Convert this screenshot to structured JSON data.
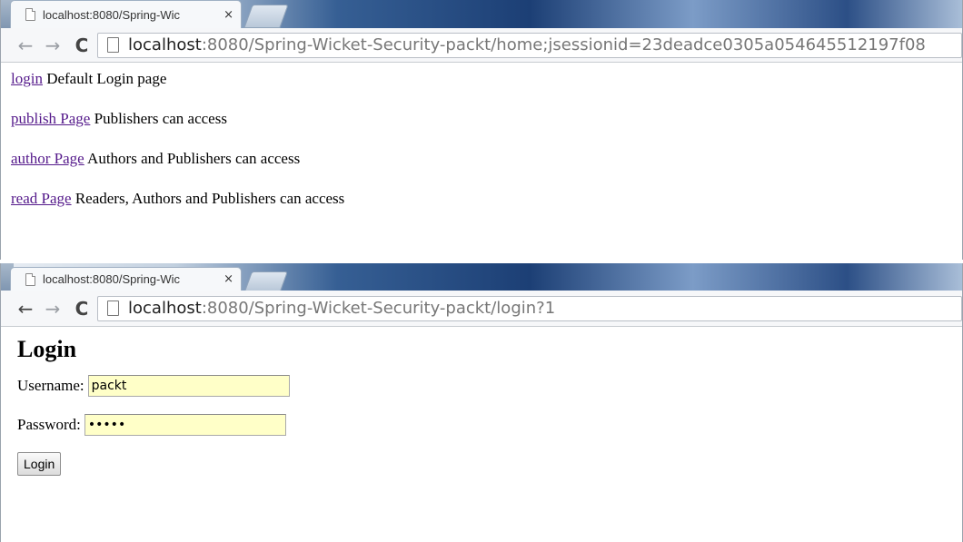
{
  "window1": {
    "tab_title": "localhost:8080/Spring-Wic",
    "tab_close": "×",
    "url_host": "localhost",
    "url_rest": ":8080/Spring-Wicket-Security-packt/home;jsessionid=23deadce0305a054645512197f08"
  },
  "home": {
    "links": [
      {
        "link": "login",
        "text": " Default Login page"
      },
      {
        "link": "publish Page",
        "text": " Publishers can access"
      },
      {
        "link": "author Page",
        "text": " Authors and Publishers can access"
      },
      {
        "link": "read Page",
        "text": " Readers, Authors and Publishers can access"
      }
    ]
  },
  "window2": {
    "tab_title": "localhost:8080/Spring-Wic",
    "tab_close": "×",
    "url_host": "localhost",
    "url_rest": ":8080/Spring-Wicket-Security-packt/login?1"
  },
  "nav": {
    "back": "←",
    "forward": "→",
    "reload": "C"
  },
  "login": {
    "heading": "Login",
    "username_label": "Username:",
    "username_value": "packt",
    "password_label": "Password:",
    "password_value": "packt",
    "button_label": "Login"
  },
  "colors": {
    "link": "#551a8b",
    "input_bg": "#ffffc8"
  }
}
